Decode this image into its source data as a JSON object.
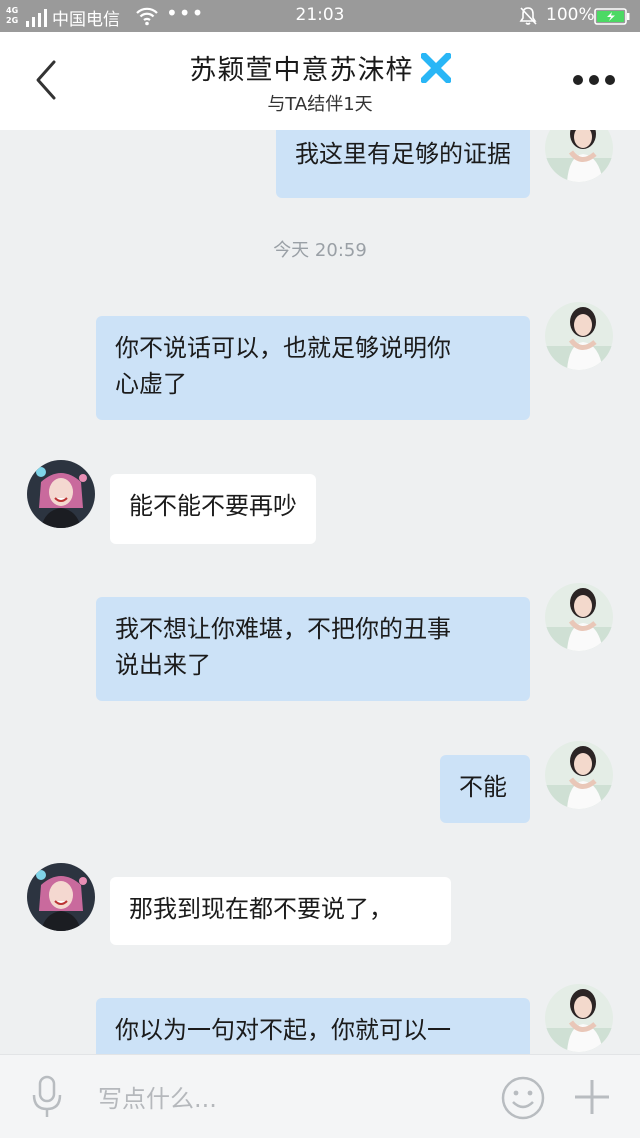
{
  "status_bar": {
    "network_top": "4G",
    "network_bottom": "2G",
    "carrier": "中国电信",
    "dots": "•••",
    "time": "21:03",
    "battery_pct": "100%",
    "battery_color": "#4cd964"
  },
  "header": {
    "title": "苏颖萱中意苏沫梓",
    "subtitle": "与TA结伴1天",
    "badge_color": "#29b6f6"
  },
  "messages": [
    {
      "from": "me",
      "text": "我这里有足够的证据"
    },
    {
      "type": "time",
      "text": "今天 20:59"
    },
    {
      "from": "me",
      "text_lines": [
        "你不说话可以，也就足够说明你",
        "心虚了"
      ]
    },
    {
      "from": "other",
      "text": "能不能不要再吵"
    },
    {
      "from": "me",
      "text_lines": [
        "我不想让你难堪，不把你的丑事",
        "说出来了"
      ]
    },
    {
      "from": "me",
      "text": "不能"
    },
    {
      "from": "other",
      "text": "那我到现在都不要说了，"
    },
    {
      "from": "me",
      "text": "你以为一句对不起，你就可以一"
    }
  ],
  "input": {
    "placeholder": "写点什么..."
  },
  "colors": {
    "my_bubble": "#cce2f7",
    "other_bubble": "#ffffff",
    "chat_background": "#eef0f1"
  }
}
